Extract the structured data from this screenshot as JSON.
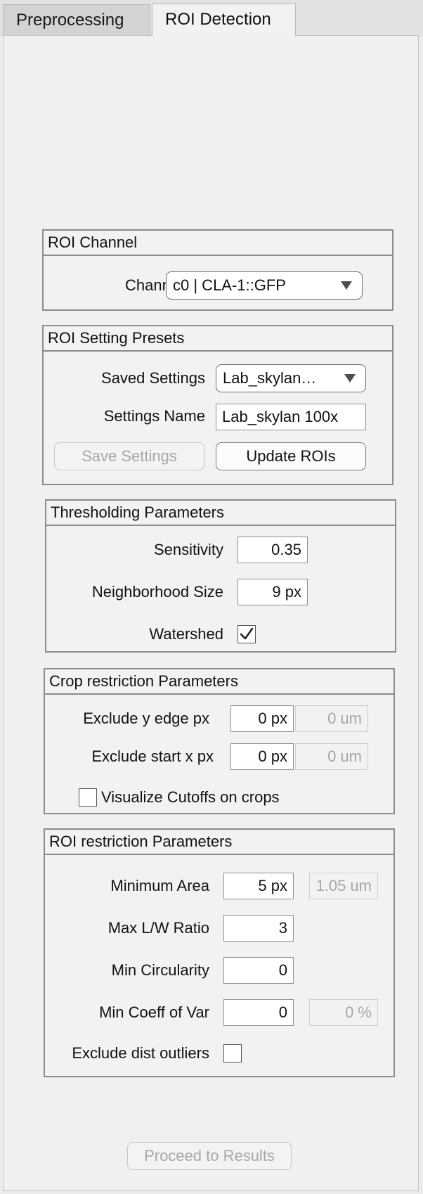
{
  "tabs": [
    {
      "label": "Preprocessing",
      "active": false
    },
    {
      "label": "ROI Detection",
      "active": true
    }
  ],
  "roi_channel": {
    "title": "ROI Channel",
    "channel_label": "Channel",
    "channel_value": "c0 | CLA-1::GFP"
  },
  "presets": {
    "title": "ROI Setting Presets",
    "saved_settings_label": "Saved Settings",
    "saved_settings_value": "Lab_skylan…",
    "settings_name_label": "Settings Name",
    "settings_name_value": "Lab_skylan 100x",
    "save_button": "Save Settings",
    "update_button": "Update ROIs"
  },
  "thresholding": {
    "title": "Thresholding Parameters",
    "sensitivity_label": "Sensitivity",
    "sensitivity_value": "0.35",
    "neighborhood_label": "Neighborhood Size",
    "neighborhood_value": "9 px",
    "watershed_label": "Watershed",
    "watershed_checked": true
  },
  "crop": {
    "title": "Crop restriction Parameters",
    "exclude_y_label": "Exclude y edge px",
    "exclude_y_px": "0 px",
    "exclude_y_um": "0 um",
    "exclude_x_label": "Exclude start x px",
    "exclude_x_px": "0 px",
    "exclude_x_um": "0 um",
    "visualize_label": "Visualize Cutoffs on crops",
    "visualize_checked": false
  },
  "roi_restriction": {
    "title": "ROI restriction Parameters",
    "min_area_label": "Minimum Area",
    "min_area_px": "5 px",
    "min_area_um": "1.05 um",
    "max_lw_label": "Max L/W Ratio",
    "max_lw_value": "3",
    "min_circ_label": "Min Circularity",
    "min_circ_value": "0",
    "min_coeff_label": "Min Coeff of Var",
    "min_coeff_value": "0",
    "min_coeff_pct": "0 %",
    "exclude_outliers_label": "Exclude dist outliers",
    "exclude_outliers_checked": false
  },
  "proceed_button": "Proceed to Results"
}
